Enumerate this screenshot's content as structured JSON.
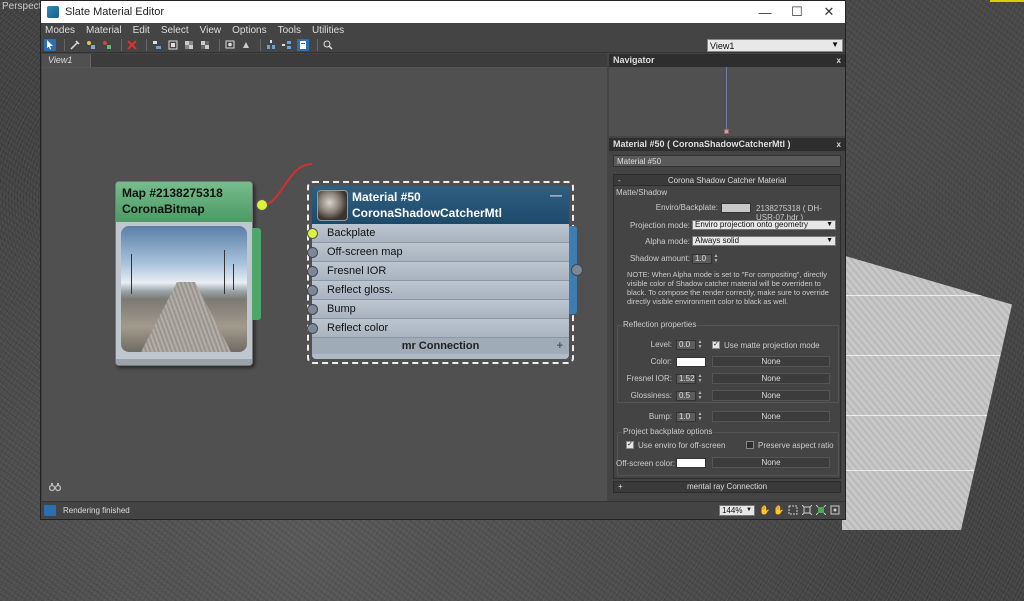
{
  "viewport": {
    "label": "Perspective"
  },
  "window": {
    "title": "Slate Material Editor",
    "controls": {
      "minimize": "—",
      "maximize": "☐",
      "close": "✕"
    }
  },
  "menu": [
    "Modes",
    "Material",
    "Edit",
    "Select",
    "View",
    "Options",
    "Tools",
    "Utilities"
  ],
  "view_selector": {
    "value": "View1"
  },
  "view_tab": {
    "label": "View1"
  },
  "nodes": {
    "map": {
      "title_line1": "Map #2138275318",
      "title_line2": "CoronaBitmap"
    },
    "material": {
      "title_line1": "Material #50",
      "title_line2": "CoronaShadowCatcherMtl",
      "collapse": "—",
      "slots": [
        "Backplate",
        "Off-screen map",
        "Fresnel IOR",
        "Reflect gloss.",
        "Bump",
        "Reflect color"
      ],
      "mr_connection": "mr Connection",
      "mr_plus": "+"
    }
  },
  "navigator": {
    "title": "Navigator",
    "close": "x"
  },
  "params": {
    "title": "Material #50  ( CoronaShadowCatcherMtl )",
    "close": "x",
    "name_field": "Material #50",
    "rollout_title": "Corona Shadow Catcher Material",
    "rollout_toggle": "-",
    "matte_group": "Matte/Shadow",
    "enviro_label": "Enviro/Backplate:",
    "enviro_value": "2138275318  ( DH-USR-07.hdr )",
    "projection_label": "Projection mode:",
    "projection_value": "Enviro projection onto geometry",
    "alpha_label": "Alpha mode:",
    "alpha_value": "Always solid",
    "shadow_label": "Shadow amount:",
    "shadow_value": "1.0",
    "note": "NOTE: When Alpha mode is set to \"For compositing\", directly visible color of Shadow catcher material will be overriden to black. To compose the render correctly, make sure to override directly visible environment color to black as well.",
    "reflection_group": "Reflection properties",
    "level_label": "Level:",
    "level_value": "0.0",
    "use_matte_label": "Use matte projection mode",
    "use_matte_checked": true,
    "color_label": "Color:",
    "fresnel_label": "Fresnel IOR:",
    "fresnel_value": "1.52",
    "gloss_label": "Glossiness:",
    "gloss_value": "0.5",
    "bump_label": "Bump:",
    "bump_value": "1.0",
    "none_label": "None",
    "backplate_group": "Project backplate options",
    "use_enviro_label": "Use enviro for off-screen",
    "use_enviro_checked": true,
    "preserve_aspect_label": "Preserve aspect ratio",
    "preserve_aspect_checked": false,
    "offscreen_label": "Off-screen color:",
    "mr_rollout_toggle": "+",
    "mr_rollout": "mental ray Connection",
    "colors": {
      "color_swatch": "#ffffff",
      "offscreen_swatch": "#ffffff",
      "enviro_swatch": "#c8c8c8"
    }
  },
  "statusbar": {
    "text": "Rendering finished",
    "zoom": "144%"
  }
}
